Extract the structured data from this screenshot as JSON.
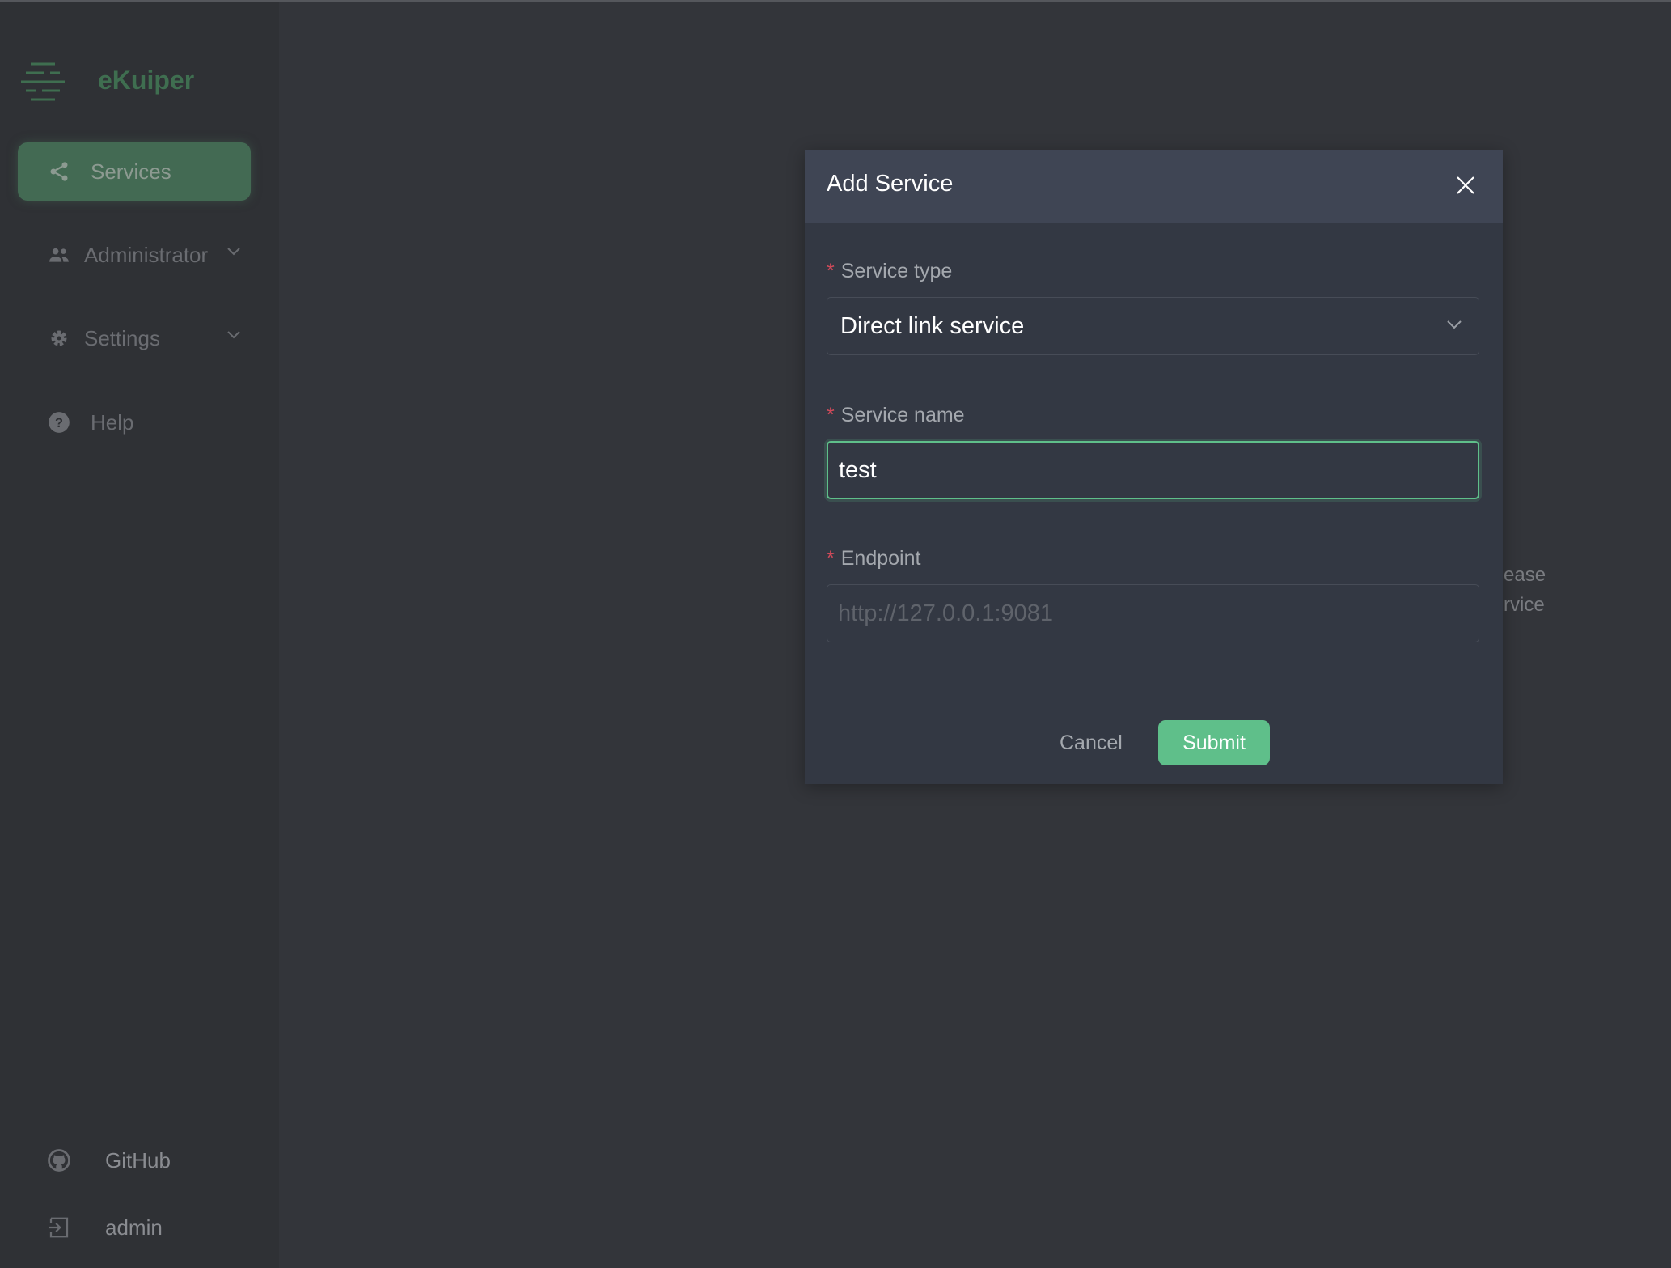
{
  "app": {
    "name": "eKuiper",
    "accent": "#5fbf8a"
  },
  "sidebar": {
    "items": [
      {
        "label": "Services",
        "icon": "share-icon",
        "active": true
      },
      {
        "label": "Administrator",
        "icon": "users-icon",
        "expandable": true
      },
      {
        "label": "Settings",
        "icon": "gear-icon",
        "expandable": true
      },
      {
        "label": "Help",
        "icon": "help-circle-icon"
      }
    ],
    "footer": [
      {
        "label": "GitHub",
        "icon": "github-icon"
      },
      {
        "label": "admin",
        "icon": "logout-icon"
      }
    ]
  },
  "background": {
    "text_line1": "ease",
    "text_line2": "rvice"
  },
  "modal": {
    "title": "Add Service",
    "fields": [
      {
        "label": "Service type",
        "required": true,
        "value": "Direct link service"
      },
      {
        "label": "Service name",
        "required": true,
        "value": "test"
      },
      {
        "label": "Endpoint",
        "required": true,
        "value": "",
        "placeholder": "http://127.0.0.1:9081"
      }
    ],
    "required_mark": "*",
    "cancel_label": "Cancel",
    "submit_label": "Submit"
  }
}
